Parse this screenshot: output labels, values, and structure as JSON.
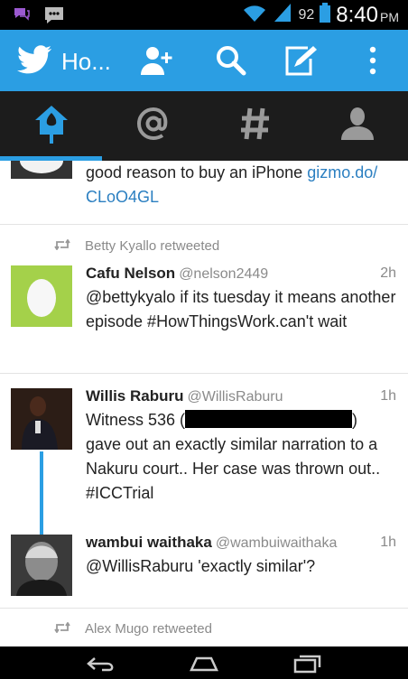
{
  "status_bar": {
    "battery_pct": "92",
    "time": "8:40",
    "ampm": "PM"
  },
  "action_bar": {
    "title": "Ho...",
    "colors": {
      "accent": "#2b9ee3"
    }
  },
  "tabs": [
    {
      "name": "home-tab",
      "icon": "home-icon",
      "selected": true
    },
    {
      "name": "mentions-tab",
      "icon": "at-icon",
      "selected": false
    },
    {
      "name": "discover-tab",
      "icon": "hashtag-icon",
      "selected": false
    },
    {
      "name": "me-tab",
      "icon": "person-icon",
      "selected": false
    }
  ],
  "timeline": {
    "partial_tweet": {
      "text": "good reason to buy an iPhone ",
      "link1": "gizmo.do/",
      "link2": "CLoO4GL"
    },
    "retweet_1": {
      "by": "Betty Kyallo retweeted",
      "name": "Cafu Nelson",
      "handle": "@nelson2449",
      "time": "2h",
      "text": "@bettykyalo if its tuesday it means another episode #HowThingsWork.can't wait"
    },
    "tweet_2": {
      "name": "Willis Raburu",
      "handle": "@WillisRaburu",
      "time": "1h",
      "text_before": "Witness 536 (",
      "text_after": ") gave out an exactly similar narration to a Nakuru court.. Her case was thrown out.. #ICCTrial"
    },
    "tweet_3": {
      "name": "wambui waithaka",
      "handle": "@wambuiwaithaka",
      "time": "1h",
      "text": "@WillisRaburu 'exactly similar'?"
    },
    "retweet_4": {
      "by": "Alex Mugo retweeted"
    }
  }
}
